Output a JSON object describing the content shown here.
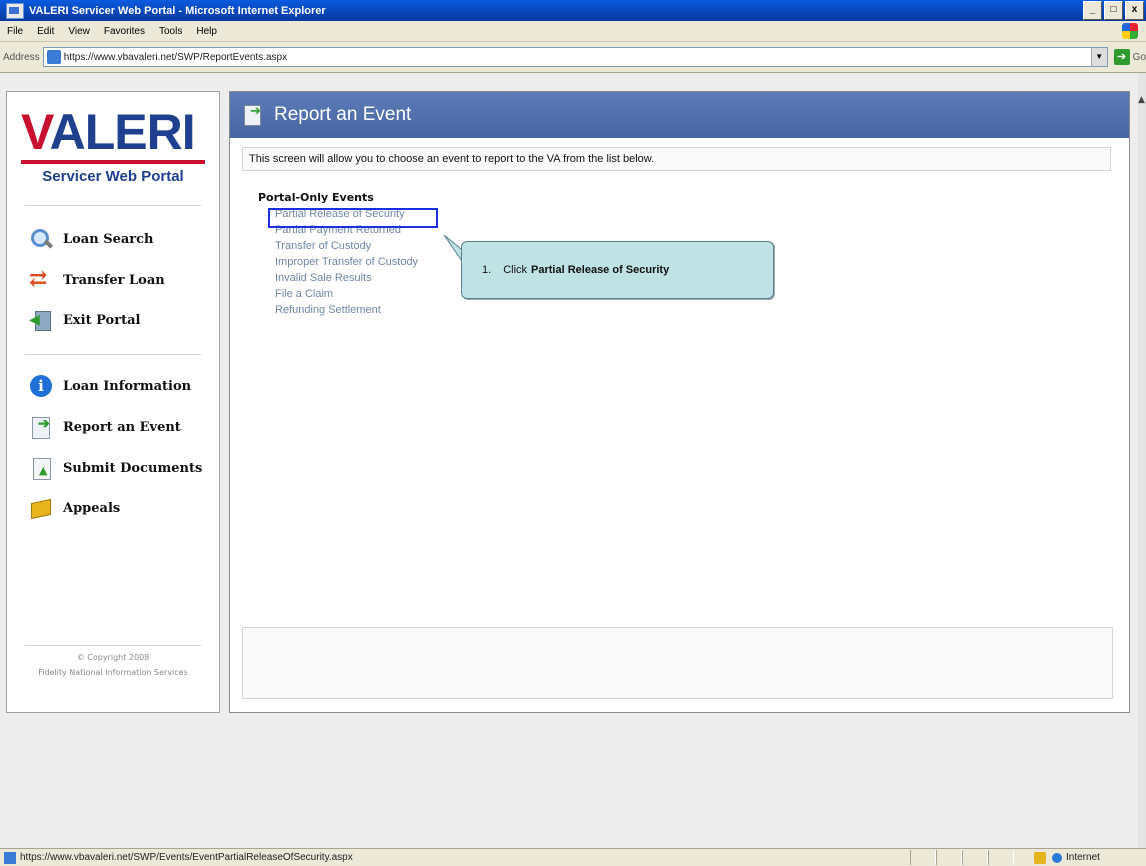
{
  "window": {
    "title": "VALERI Servicer Web Portal - Microsoft Internet Explorer",
    "minimize": "_",
    "maximize": "□",
    "close": "x"
  },
  "menu": [
    "File",
    "Edit",
    "View",
    "Favorites",
    "Tools",
    "Help"
  ],
  "address": {
    "label": "Address",
    "url": "https://www.vbavaleri.net/SWP/ReportEvents.aspx",
    "go": "Go"
  },
  "sidebar": {
    "logo_text": "VALERI",
    "subtitle": "Servicer Web Portal",
    "nav_top": [
      {
        "label": "Loan Search",
        "icon": "search-icon"
      },
      {
        "label": "Transfer Loan",
        "icon": "transfer-icon"
      },
      {
        "label": "Exit Portal",
        "icon": "exit-icon"
      }
    ],
    "nav_bottom": [
      {
        "label": "Loan Information",
        "icon": "info-icon"
      },
      {
        "label": "Report an Event",
        "icon": "report-icon"
      },
      {
        "label": "Submit Documents",
        "icon": "documents-icon"
      },
      {
        "label": "Appeals",
        "icon": "appeals-icon"
      }
    ],
    "copyright_line1": "© Copyright 2008",
    "copyright_line2": "Fidelity National Information Services"
  },
  "main": {
    "title": "Report an Event",
    "instruction": "This screen will allow you to choose an event to report to the VA from the list below.",
    "section_title": "Portal-Only Events",
    "events": [
      "Partial Release of Security",
      "Partial Payment Returned",
      "Transfer of Custody",
      "Improper Transfer of Custody",
      "Invalid Sale Results",
      "File a Claim",
      "Refunding Settlement"
    ]
  },
  "callout": {
    "number": "1.",
    "prefix": "Click",
    "bold": "Partial Release of Security"
  },
  "status": {
    "url": "https://www.vbavaleri.net/SWP/Events/EventPartialReleaseOfSecurity.aspx",
    "zone": "Internet"
  }
}
